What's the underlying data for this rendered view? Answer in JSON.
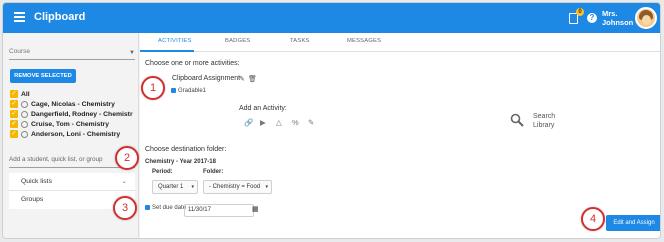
{
  "app": {
    "title": "Clipboard",
    "notification_count": "0"
  },
  "user": {
    "line1": "Mrs.",
    "line2": "Johnson"
  },
  "sidebar": {
    "course_placeholder": "Course",
    "remove_label": "REMOVE SELECTED",
    "students": [
      {
        "name": "All"
      },
      {
        "name": "Cage, Nicolas - Chemistry"
      },
      {
        "name": "Dangerfield, Rodney - Chemistr"
      },
      {
        "name": "Cruise, Tom - Chemistry"
      },
      {
        "name": "Anderson, Loni - Chemistry"
      }
    ],
    "add_placeholder": "Add a student, quick list, or group",
    "quick_lists": "Quick lists",
    "groups": "Groups"
  },
  "tabs": [
    "ACTIVITIES",
    "BADGES",
    "TASKS",
    "MESSAGES"
  ],
  "main": {
    "choose_activities": "Choose one or more activities:",
    "assignment_title": "Clipboard Assignment",
    "gradable": "Gradable1",
    "add_activity": "Add an Activity:",
    "search_library": "Search\nLibrary",
    "choose_folder": "Choose destination folder:",
    "folder_year": "Chemistry - Year 2017-18",
    "period_label": "Period:",
    "folder_label": "Folder:",
    "period_value": "Quarter 1",
    "folder_value": "- Chemistry = Food",
    "set_due_date": "Set due date",
    "due_date": "11/30/17",
    "edit_assign": "Edit and Assign"
  },
  "steps": [
    "1",
    "2",
    "3",
    "4"
  ],
  "colors": {
    "primary": "#1e88e5",
    "checkbox": "#f6b700",
    "step_border": "#d32f2f"
  },
  "icons": [
    "menu-icon",
    "clipboard-icon",
    "help-icon",
    "pencil-icon",
    "trash-icon",
    "link-icon",
    "youtube-icon",
    "drive-icon",
    "search-icon",
    "calendar-icon"
  ]
}
